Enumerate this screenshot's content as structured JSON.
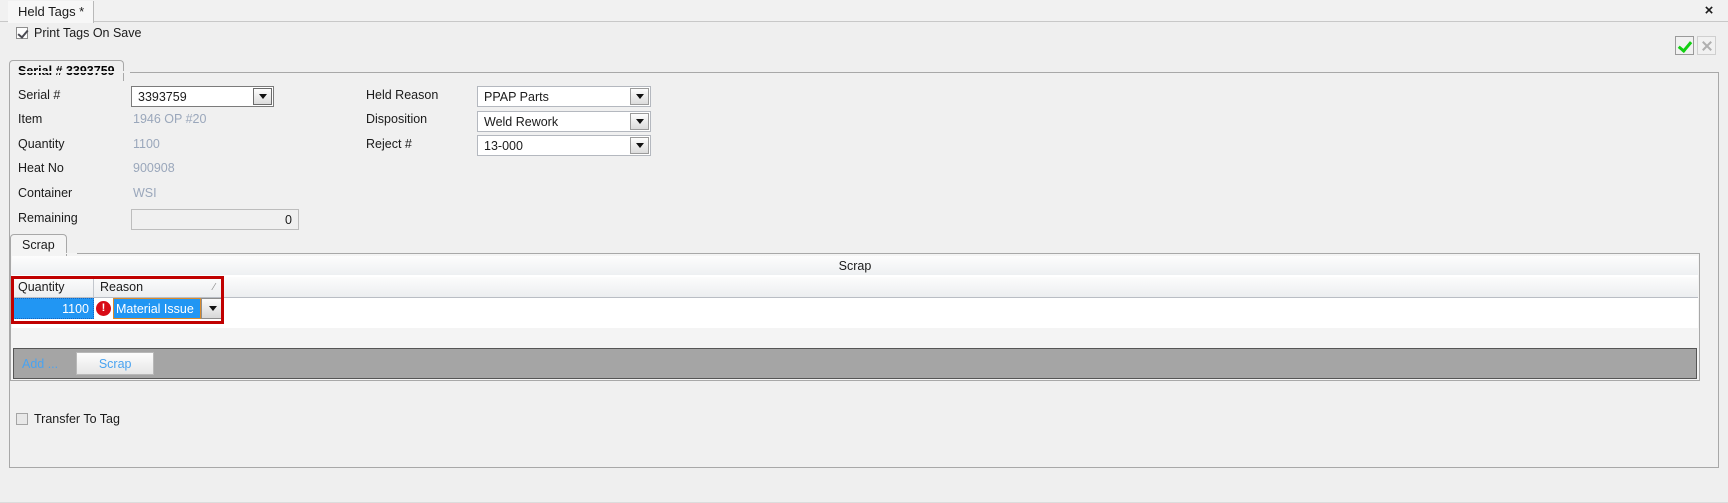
{
  "window": {
    "doc_tab_label": "Held Tags *",
    "close_icon": "close-icon",
    "close_glyph": "×"
  },
  "toolbar": {
    "print_tags_label": "Print Tags On Save",
    "print_tags_checked": true,
    "confirm_icon": "checkmark-icon",
    "cancel_icon": "x-icon"
  },
  "serial_group": {
    "tab_label": "Serial # 3393759",
    "left_fields": [
      {
        "label": "Serial #",
        "value": "3393759",
        "type": "combo"
      },
      {
        "label": "Item",
        "value": "1946 OP #20",
        "type": "readonly"
      },
      {
        "label": "Quantity",
        "value": "1100",
        "type": "readonly"
      },
      {
        "label": "Heat No",
        "value": "900908",
        "type": "readonly"
      },
      {
        "label": "Container",
        "value": "WSI",
        "type": "readonly"
      },
      {
        "label": "Remaining",
        "value": "0",
        "type": "textbox"
      }
    ],
    "right_fields": [
      {
        "label": "Held Reason",
        "value": "PPAP Parts",
        "type": "combo"
      },
      {
        "label": "Disposition",
        "value": "Weld Rework",
        "type": "combo"
      },
      {
        "label": "Reject #",
        "value": "13-000",
        "type": "combo"
      }
    ]
  },
  "scrap_section": {
    "tab_label": "Scrap",
    "grid_caption": "Scrap",
    "columns": [
      {
        "label": "Quantity",
        "sort_mark": ""
      },
      {
        "label": "Reason",
        "sort_mark": "⁄"
      }
    ],
    "rows": [
      {
        "quantity": "1100",
        "reason": "Material Issue",
        "has_error": true,
        "error_glyph": "!"
      }
    ],
    "add_link_label": "Add ...",
    "scrap_button_label": "Scrap"
  },
  "footer": {
    "transfer_label": "Transfer To Tag",
    "transfer_checked": false
  },
  "colors": {
    "selection_blue": "#2196f3",
    "error_red": "#d80b16",
    "highlight_outline": "#c00000",
    "link_blue": "#4aa3f0",
    "readonly_text": "#9aa7bb",
    "button_bar": "#a5a5a5"
  }
}
